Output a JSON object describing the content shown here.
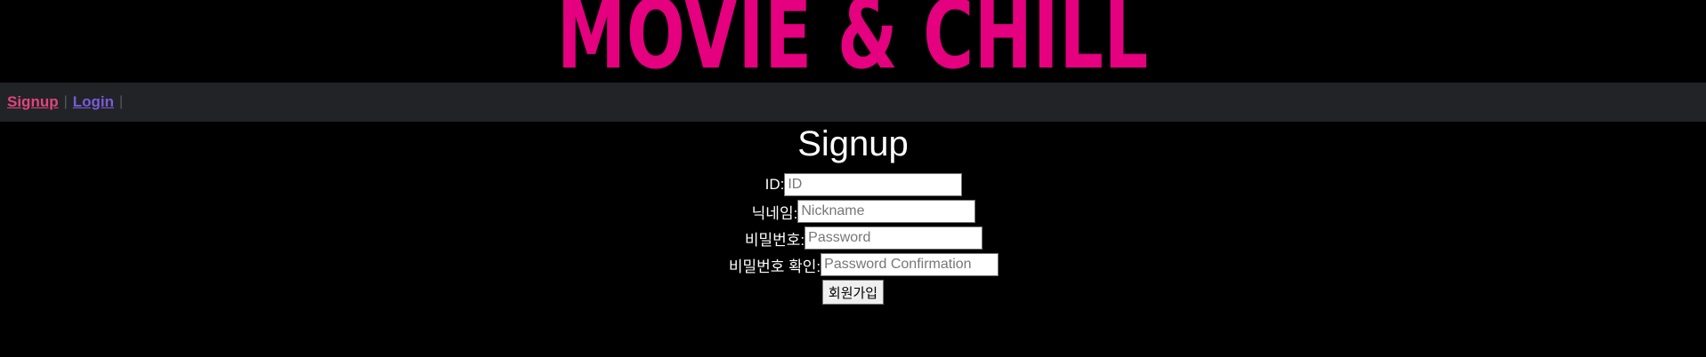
{
  "header": {
    "logo_text": "MOVIE & CHILL",
    "logo_color": "#e4007f"
  },
  "nav": {
    "items": [
      {
        "label": "Signup",
        "color": "#e0457b"
      },
      {
        "label": "Login",
        "color": "#7a5cd6"
      }
    ],
    "separator": "|",
    "background": "#212327"
  },
  "signup": {
    "title": "Signup",
    "fields": [
      {
        "label": "ID:",
        "placeholder": "ID"
      },
      {
        "label": "닉네임:",
        "placeholder": "Nickname"
      },
      {
        "label": "비밀번호:",
        "placeholder": "Password"
      },
      {
        "label": "비밀번호 확인:",
        "placeholder": "Password Confirmation"
      }
    ],
    "submit_label": "회원가입"
  }
}
